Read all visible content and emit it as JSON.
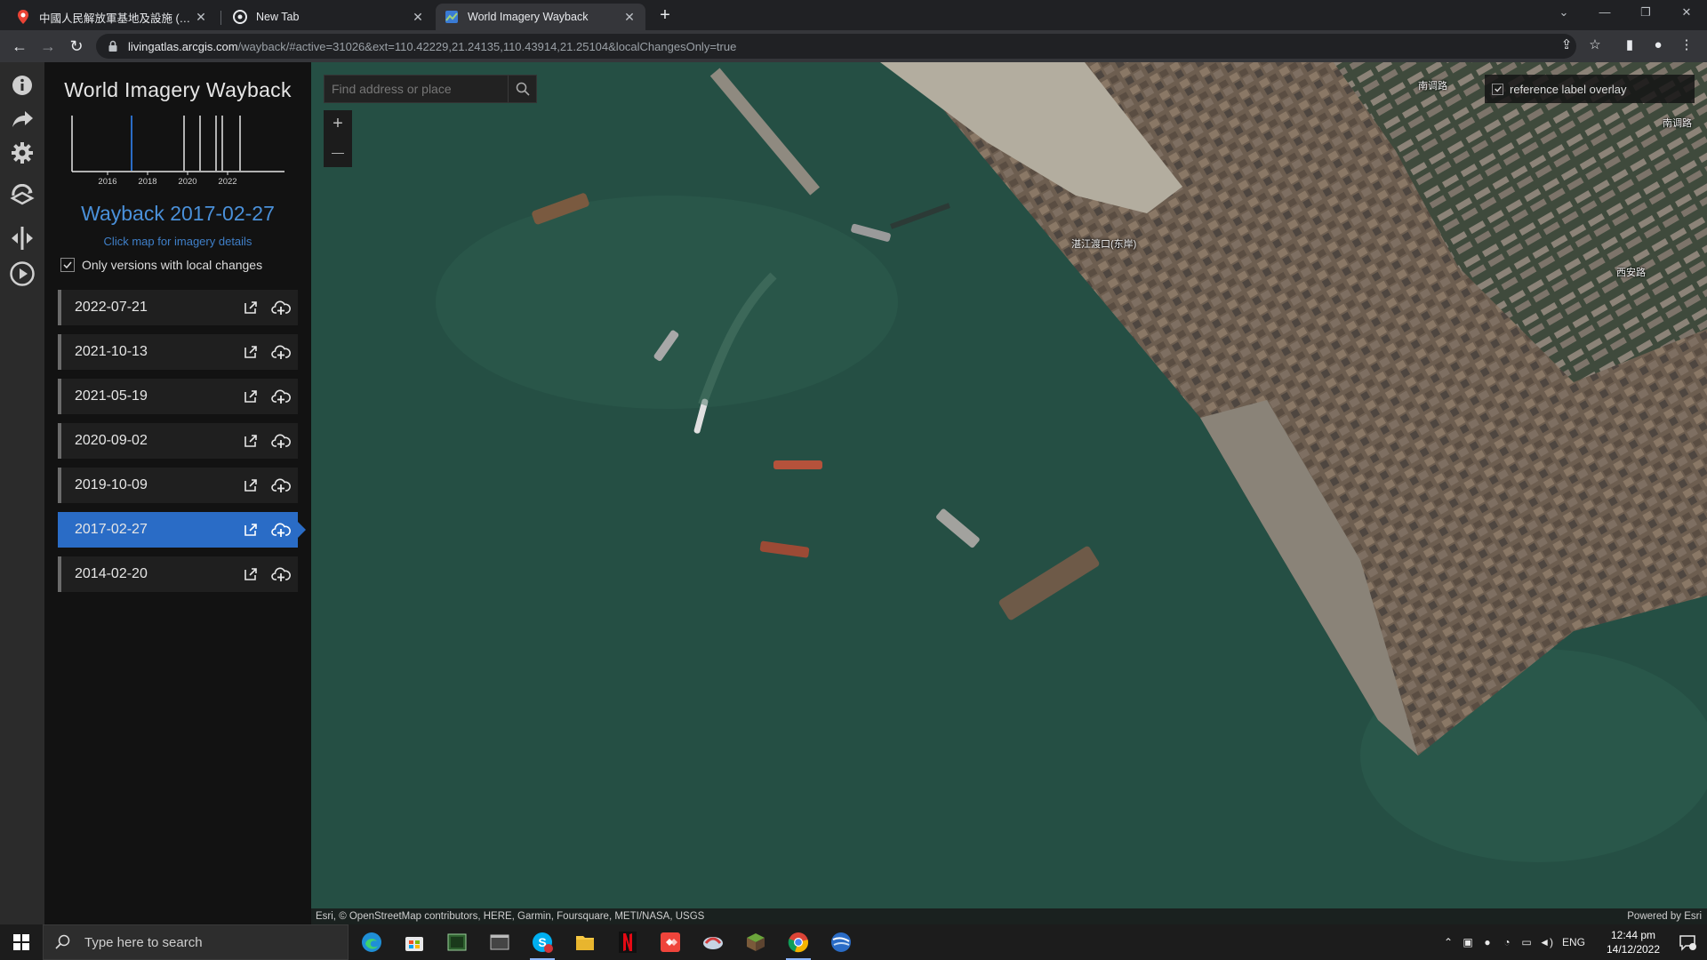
{
  "browser": {
    "tabs": [
      {
        "title": "中國人民解放軍基地及設施 (持續",
        "favicon": "map-pin-icon",
        "active": false
      },
      {
        "title": "New Tab",
        "favicon": "chrome-icon",
        "active": false
      },
      {
        "title": "World Imagery Wayback",
        "favicon": "wayback-icon",
        "active": true
      }
    ],
    "url_host": "livingatlas.arcgis.com",
    "url_path": "/wayback/#active=31026&ext=110.42229,21.24135,110.43914,21.25104&localChangesOnly=true"
  },
  "rail": {
    "items": [
      {
        "name": "info-icon"
      },
      {
        "name": "share-icon"
      },
      {
        "name": "gear-icon"
      },
      {
        "name": "layers-icon"
      },
      {
        "name": "swipe-icon"
      },
      {
        "name": "play-icon"
      }
    ]
  },
  "panel": {
    "title": "World Imagery Wayback",
    "chart": {
      "tick_labels": [
        "2016",
        "2018",
        "2020",
        "2022"
      ]
    },
    "selected_title": "Wayback 2017-02-27",
    "click_hint": "Click map for imagery details",
    "local_changes_label": "Only versions with local changes",
    "local_changes_checked": true,
    "releases": [
      {
        "date": "2022-07-21",
        "active": false
      },
      {
        "date": "2021-10-13",
        "active": false
      },
      {
        "date": "2021-05-19",
        "active": false
      },
      {
        "date": "2020-09-02",
        "active": false
      },
      {
        "date": "2019-10-09",
        "active": false
      },
      {
        "date": "2017-02-27",
        "active": true
      },
      {
        "date": "2014-02-20",
        "active": false
      }
    ]
  },
  "map": {
    "search_placeholder": "Find address or place",
    "zoom_in": "+",
    "zoom_out": "—",
    "reference_overlay_label": "reference label overlay",
    "labels": [
      "南调路",
      "南调路",
      "湛江渡口(东岸)",
      "西安路"
    ],
    "attribution": "Esri, © OpenStreetMap contributors, HERE, Garmin, Foursquare, METI/NASA, USGS",
    "powered_by": "Powered by Esri"
  },
  "taskbar": {
    "search_placeholder": "Type here to search",
    "apps": [
      "edge-icon",
      "store-icon",
      "terminal-icon",
      "window-icon",
      "skype-icon",
      "explorer-icon",
      "netflix-icon",
      "anydesk-icon",
      "app-icon",
      "minecraft-icon",
      "chrome-icon",
      "earth-icon"
    ],
    "language": "ENG",
    "time": "12:44 pm",
    "date": "14/12/2022"
  },
  "colors": {
    "accent": "#2a6cc6",
    "accent_text": "#4a90d9",
    "water": "#254f44",
    "panel_bg": "#121212"
  }
}
